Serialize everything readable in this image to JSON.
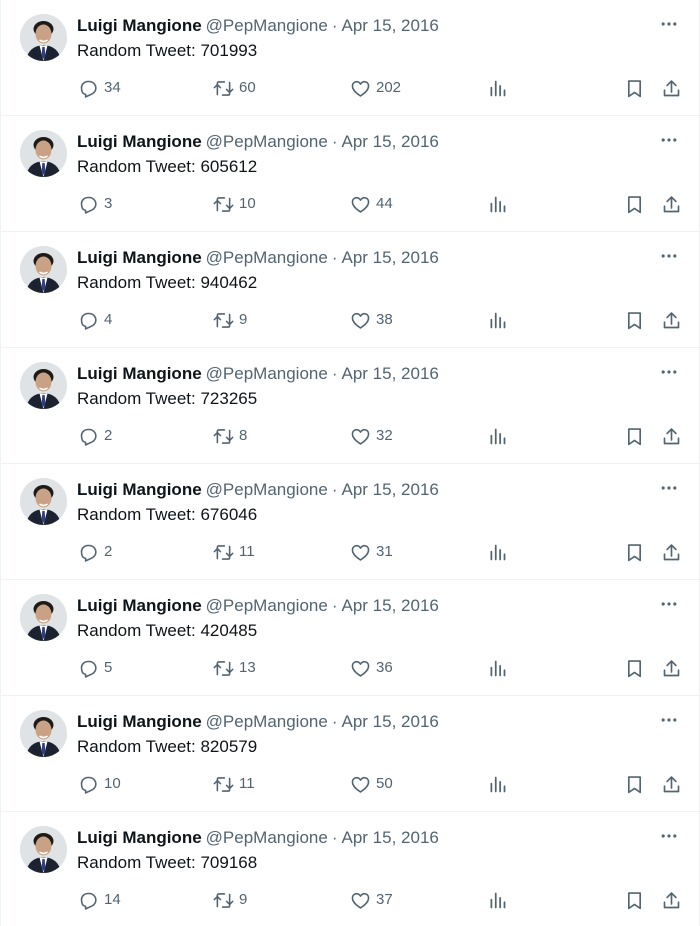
{
  "tweets": [
    {
      "name": "Luigi Mangione",
      "handle": "@PepMangione",
      "separator": "·",
      "date": "Apr 15, 2016",
      "text": "Random Tweet: 701993",
      "replies": "34",
      "retweets": "60",
      "likes": "202"
    },
    {
      "name": "Luigi Mangione",
      "handle": "@PepMangione",
      "separator": "·",
      "date": "Apr 15, 2016",
      "text": "Random Tweet: 605612",
      "replies": "3",
      "retweets": "10",
      "likes": "44"
    },
    {
      "name": "Luigi Mangione",
      "handle": "@PepMangione",
      "separator": "·",
      "date": "Apr 15, 2016",
      "text": "Random Tweet: 940462",
      "replies": "4",
      "retweets": "9",
      "likes": "38"
    },
    {
      "name": "Luigi Mangione",
      "handle": "@PepMangione",
      "separator": "·",
      "date": "Apr 15, 2016",
      "text": "Random Tweet: 723265",
      "replies": "2",
      "retweets": "8",
      "likes": "32"
    },
    {
      "name": "Luigi Mangione",
      "handle": "@PepMangione",
      "separator": "·",
      "date": "Apr 15, 2016",
      "text": "Random Tweet: 676046",
      "replies": "2",
      "retweets": "11",
      "likes": "31"
    },
    {
      "name": "Luigi Mangione",
      "handle": "@PepMangione",
      "separator": "·",
      "date": "Apr 15, 2016",
      "text": "Random Tweet: 420485",
      "replies": "5",
      "retweets": "13",
      "likes": "36"
    },
    {
      "name": "Luigi Mangione",
      "handle": "@PepMangione",
      "separator": "·",
      "date": "Apr 15, 2016",
      "text": "Random Tweet: 820579",
      "replies": "10",
      "retweets": "11",
      "likes": "50"
    },
    {
      "name": "Luigi Mangione",
      "handle": "@PepMangione",
      "separator": "·",
      "date": "Apr 15, 2016",
      "text": "Random Tweet: 709168",
      "replies": "14",
      "retweets": "9",
      "likes": "37"
    }
  ],
  "icons": {
    "more": "more-horizontal-icon",
    "reply": "reply-bubble-icon",
    "retweet": "retweet-icon",
    "like": "heart-icon",
    "views": "analytics-bars-icon",
    "bookmark": "bookmark-icon",
    "share": "share-upload-icon"
  },
  "colors": {
    "text_primary": "#0f1419",
    "text_secondary": "#536471",
    "divider": "#eff3f4",
    "background": "#ffffff"
  }
}
